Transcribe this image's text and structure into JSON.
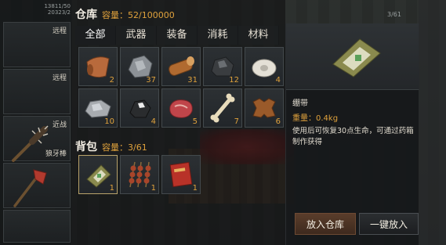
{
  "left_panel": {
    "info_line_1": "13811/50",
    "info_line_2": "20323/2",
    "slots": [
      {
        "label": "远程",
        "label_pos": "top"
      },
      {
        "label": "远程",
        "label_pos": "top"
      },
      {
        "label": "近战",
        "label_pos": "top"
      },
      {
        "label": "狼牙棒",
        "label_pos": "bottom"
      },
      {
        "label": "",
        "label_pos": "none"
      }
    ]
  },
  "warehouse": {
    "title": "仓库",
    "capacity_label": "容量：",
    "capacity_value": "52/100000",
    "tabs": [
      "全部",
      "武器",
      "装备",
      "消耗",
      "材料"
    ],
    "active_tab": 0,
    "items": [
      {
        "icon": "leather-roll-icon",
        "count": "2"
      },
      {
        "icon": "iron-ore-icon",
        "count": "37"
      },
      {
        "icon": "wood-log-icon",
        "count": "31"
      },
      {
        "icon": "coal-icon",
        "count": "12"
      },
      {
        "icon": "cloth-roll-icon",
        "count": "4"
      },
      {
        "icon": "stone-icon",
        "count": "10"
      },
      {
        "icon": "black-ore-icon",
        "count": "4"
      },
      {
        "icon": "raw-meat-icon",
        "count": "5"
      },
      {
        "icon": "bone-icon",
        "count": "7"
      },
      {
        "icon": "animal-hide-icon",
        "count": "6"
      }
    ]
  },
  "backpack": {
    "title": "背包",
    "capacity_label": "容量：",
    "capacity_value": "3/61",
    "items": [
      {
        "icon": "bandage-icon",
        "count": "1",
        "selected": true
      },
      {
        "icon": "meat-skewer-icon",
        "count": "1",
        "selected": false
      },
      {
        "icon": "medkit-book-icon",
        "count": "1",
        "selected": false
      }
    ]
  },
  "detail": {
    "icon": "bandage-icon",
    "name": "绷带",
    "weight_label": "重量：",
    "weight_value": "0.4kg",
    "description": "使用后可恢复30点生命，可通过药箱制作获得",
    "store_button": "放入仓库",
    "store_all_button": "一键放入"
  },
  "page_indicator": "3/61",
  "colors": {
    "accent_orange": "#e0a23c",
    "panel_bg": "#1b1d1f",
    "store_btn": "#5a3d2b"
  }
}
